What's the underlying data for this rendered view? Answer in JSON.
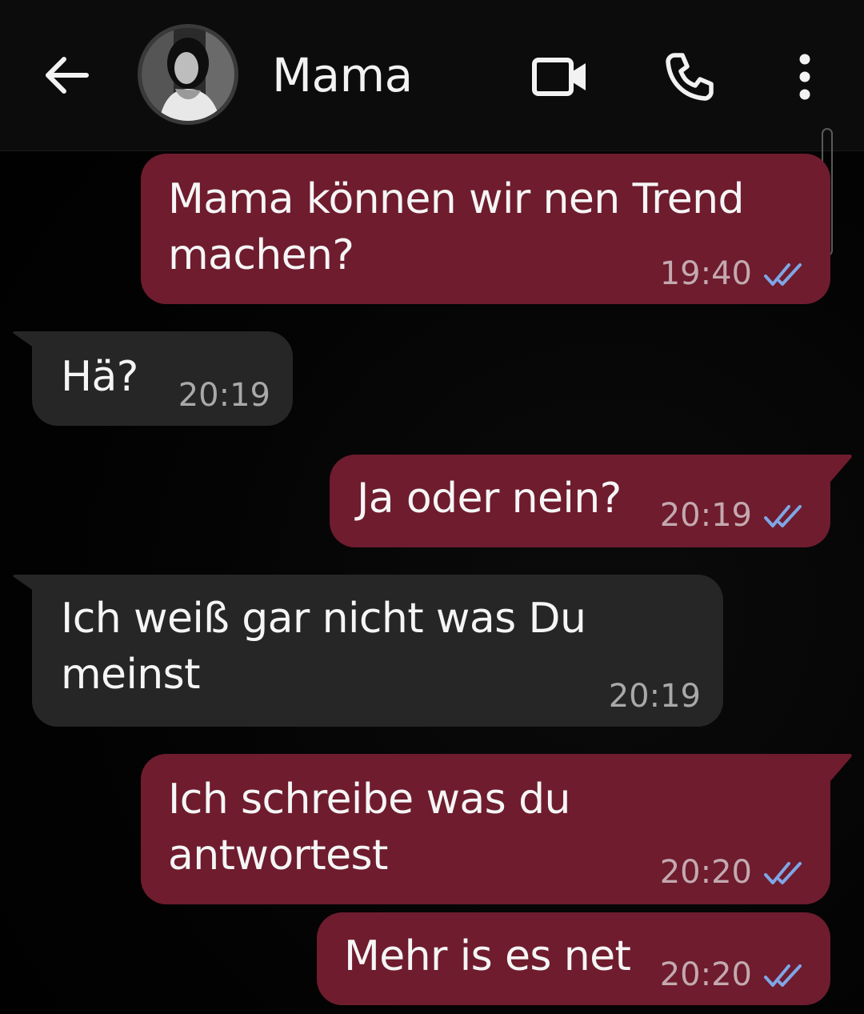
{
  "header": {
    "contact_name": "Mama",
    "back_icon": "arrow-left-icon",
    "video_icon": "video-camera-icon",
    "call_icon": "phone-icon",
    "more_icon": "more-vertical-icon"
  },
  "colors": {
    "outgoing_bubble": "#6e1c2e",
    "incoming_bubble": "#262626",
    "read_ticks": "#7fa6e6",
    "background": "#020202"
  },
  "messages": [
    {
      "direction": "out",
      "lines": [
        "Mama können wir nen Trend",
        "machen?"
      ],
      "time": "19:40",
      "status": "read"
    },
    {
      "direction": "in",
      "lines": [
        "Hä?"
      ],
      "time": "20:19"
    },
    {
      "direction": "out",
      "lines": [
        "Ja oder nein?"
      ],
      "time": "20:19",
      "status": "read"
    },
    {
      "direction": "in",
      "lines": [
        "Ich weiß gar nicht was Du",
        "meinst"
      ],
      "time": "20:19"
    },
    {
      "direction": "out",
      "lines": [
        "Ich schreibe was du",
        "antwortest"
      ],
      "time": "20:20",
      "status": "read"
    },
    {
      "direction": "out",
      "lines": [
        "Mehr is es net"
      ],
      "time": "20:20",
      "status": "read"
    }
  ]
}
